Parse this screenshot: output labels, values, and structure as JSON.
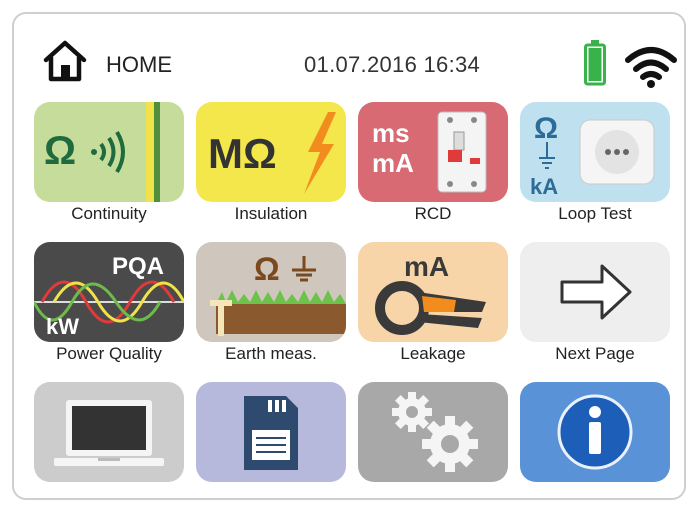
{
  "header": {
    "home_label": "HOME",
    "datetime": "01.07.2016  16:34"
  },
  "tiles": [
    {
      "label": "Continuity",
      "color": "#c6dc9b"
    },
    {
      "label": "Insulation",
      "color": "#f4e74c"
    },
    {
      "label": "RCD",
      "color": "#d86a73"
    },
    {
      "label": "Loop Test",
      "color": "#bfe1ef"
    },
    {
      "label": "Power Quality",
      "color": "#4a4a4a"
    },
    {
      "label": "Earth meas.",
      "color": "#cfc6bd"
    },
    {
      "label": "Leakage",
      "color": "#f7d5a8"
    },
    {
      "label": "Next Page",
      "color": "#eeeeee"
    },
    {
      "label": "",
      "color": "#cccccc"
    },
    {
      "label": "",
      "color": "#b6b8dc"
    },
    {
      "label": "",
      "color": "#a8a8a8"
    },
    {
      "label": "",
      "color": "#5a92d8"
    }
  ],
  "tile_text": {
    "continuity_symbol": "Ω",
    "insulation_symbol": "MΩ",
    "rcd_ms": "ms",
    "rcd_ma": "mA",
    "loop_omega": "Ω",
    "loop_ka": "kA",
    "pq_title": "PQA",
    "pq_kw": "kW",
    "earth_omega": "Ω",
    "leakage_ma": "mA"
  },
  "icons": {
    "home": "house-icon",
    "battery": "battery-icon",
    "wifi": "wifi-icon"
  }
}
